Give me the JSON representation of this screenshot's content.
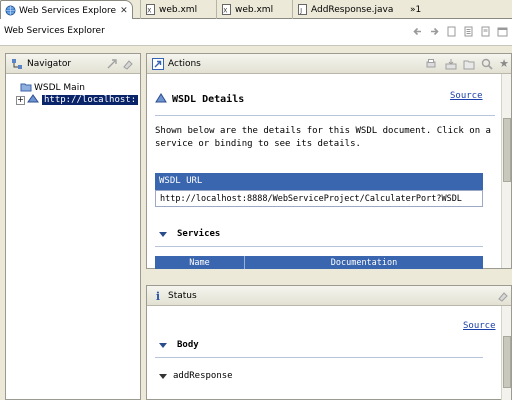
{
  "tabs": [
    {
      "label": "Web Services Explore",
      "icon": "globe-icon",
      "active": true
    },
    {
      "label": "web.xml",
      "icon": "xml-file-icon"
    },
    {
      "label": "web.xml",
      "icon": "xml-file-icon"
    },
    {
      "label": "AddResponse.java",
      "icon": "java-file-icon"
    },
    {
      "label": "»1",
      "icon": ""
    }
  ],
  "editor_title": "Web Services Explorer",
  "navigator": {
    "title": "Navigator",
    "tree": [
      {
        "label": "WSDL Main"
      },
      {
        "label": "http://localhost:"
      }
    ]
  },
  "actions": {
    "title": "Actions",
    "heading": "WSDL Details",
    "source_link": "Source",
    "description": "Shown below are the details for this WSDL document. Click on a service or binding to see its details.",
    "wsdl_url_header": "WSDL URL",
    "wsdl_url_value": "http://localhost:8888/WebServiceProject/CalculaterPort?WSDL",
    "services_title": "Services",
    "table_headers": [
      "Name",
      "Documentation"
    ]
  },
  "status": {
    "title": "Status",
    "source_link": "Source",
    "body_title": "Body",
    "item": "addResponse"
  }
}
